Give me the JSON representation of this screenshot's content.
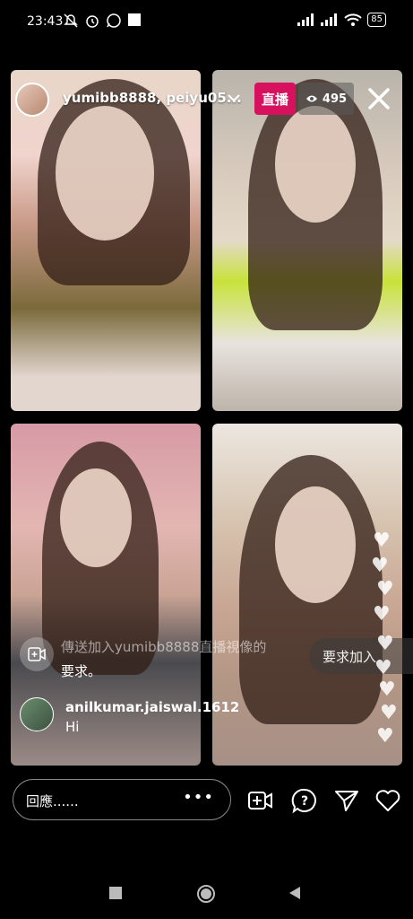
{
  "status_bar": {
    "time": "23:43",
    "battery": "85",
    "icons": [
      "mute-icon",
      "alarm-icon",
      "whatsapp-icon",
      "notification-icon",
      "signal-icon",
      "signal-icon",
      "wifi-icon",
      "battery-icon"
    ]
  },
  "live_header": {
    "names": "yumibb8888, peiyu05...",
    "live_label": "直播",
    "viewer_count": "495"
  },
  "overlay": {
    "join_request_text": "傳送加入yumibb8888直播視像的",
    "join_request_text2": "要求。",
    "request_join_button": "要求加入"
  },
  "comment": {
    "username": "anilkumar.jaiswal.1612",
    "text": "Hi"
  },
  "composer": {
    "placeholder": "回應......",
    "more": "•••"
  },
  "colors": {
    "live_badge": "#d8115f",
    "background": "#000000"
  }
}
